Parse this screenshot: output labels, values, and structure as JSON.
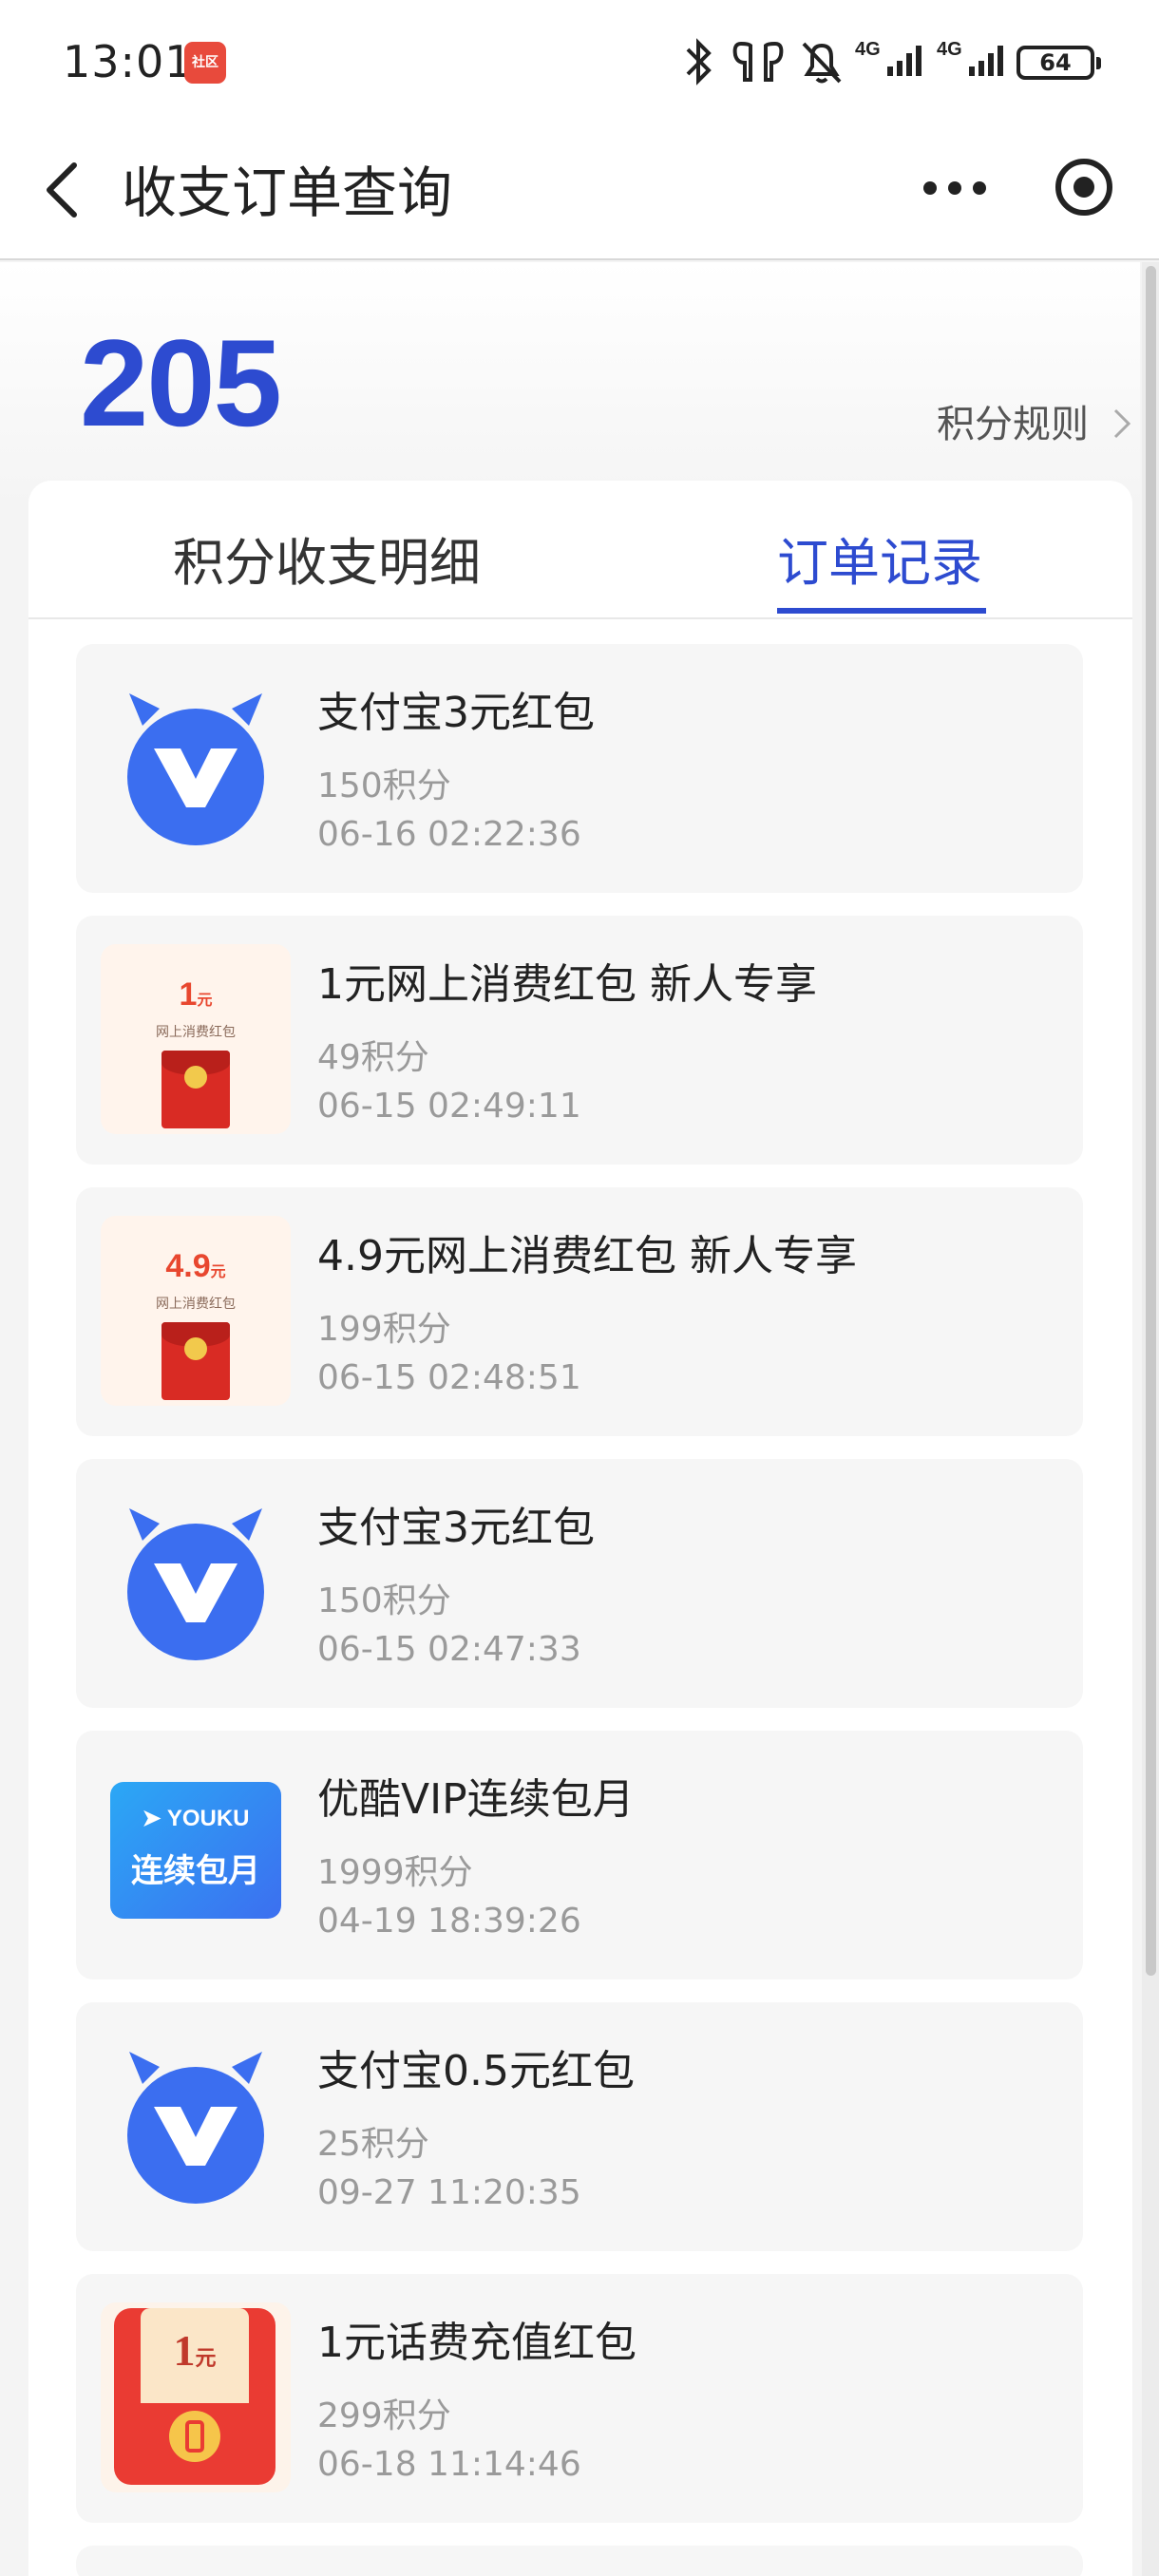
{
  "status_bar": {
    "time": "13:01",
    "app_badge": "社区",
    "icons": [
      "bluetooth-icon",
      "earbuds-icon",
      "mute-icon",
      "signal-4g-icon",
      "signal-4g-icon"
    ],
    "battery": "64"
  },
  "nav": {
    "title": "收支订单查询",
    "back_icon": "back-arrow-icon",
    "more_icon": "more-dots-icon",
    "target_icon": "target-icon"
  },
  "header": {
    "points_total": "205",
    "rules_label": "积分规则"
  },
  "tabs": [
    {
      "label": "积分收支明细",
      "active": false
    },
    {
      "label": "订单记录",
      "active": true
    }
  ],
  "orders": [
    {
      "thumb": "alipay-v-icon",
      "title": "支付宝3元红包",
      "points": "150积分",
      "time": "06-16 02:22:36"
    },
    {
      "thumb": "red-packet",
      "amount": "1",
      "unit": "元",
      "caption": "网上消费红包",
      "title": "1元网上消费红包 新人专享",
      "points": "49积分",
      "time": "06-15 02:49:11"
    },
    {
      "thumb": "red-packet",
      "amount": "4.9",
      "unit": "元",
      "caption": "网上消费红包",
      "title": "4.9元网上消费红包 新人专享",
      "points": "199积分",
      "time": "06-15 02:48:51"
    },
    {
      "thumb": "alipay-v-icon",
      "title": "支付宝3元红包",
      "points": "150积分",
      "time": "06-15 02:47:33"
    },
    {
      "thumb": "youku",
      "brand": "YOUKU",
      "badge_text": "连续包月",
      "title": "优酷VIP连续包月",
      "points": "1999积分",
      "time": "04-19 18:39:26"
    },
    {
      "thumb": "alipay-v-icon",
      "title": "支付宝0.5元红包",
      "points": "25积分",
      "time": "09-27 11:20:35"
    },
    {
      "thumb": "phone-red-packet",
      "amount": "1",
      "unit": "元",
      "title": "1元话费充值红包",
      "points": "299积分",
      "time": "06-18 11:14:46"
    }
  ],
  "colors": {
    "accent": "#2d4bd0",
    "logo_blue": "#3b6ef0",
    "red_packet": "#d92b24"
  }
}
